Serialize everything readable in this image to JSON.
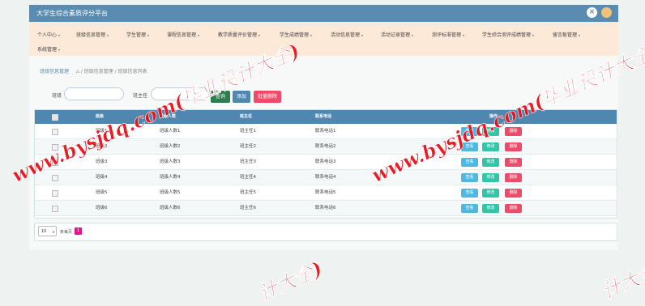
{
  "app": {
    "title": "大学生综合素质评分平台",
    "close_icon": "⨯"
  },
  "nav": [
    {
      "label": "个人中心",
      "caret": "▾"
    },
    {
      "label": "班级信息管理",
      "caret": "▾"
    },
    {
      "label": "学生管理",
      "caret": "▾"
    },
    {
      "label": "课程信息管理",
      "caret": "▾"
    },
    {
      "label": "教学质量评价管理",
      "caret": "▾"
    },
    {
      "label": "学生成绩管理",
      "caret": "▾"
    },
    {
      "label": "活动信息管理",
      "caret": "▾"
    },
    {
      "label": "活动记录管理",
      "caret": "▾"
    },
    {
      "label": "测评标准管理",
      "caret": "▾"
    },
    {
      "label": "学生综合测评成绩管理",
      "caret": "▾"
    },
    {
      "label": "留言板管理",
      "caret": "▾"
    },
    {
      "label": "系统管理",
      "caret": "▾"
    }
  ],
  "breadcrumb": {
    "current": "班级信息管理",
    "home_icon": "⌂",
    "path": "/ 班级信息管理 / 班级信息列表"
  },
  "search": {
    "class_label": "班级",
    "class_value": "",
    "teacher_label": "班主任",
    "teacher_value": "",
    "search_button": "查询",
    "add_button": "添加",
    "batch_delete_button": "批量删除"
  },
  "table": {
    "headers": [
      "",
      "班级",
      "班级人数",
      "班主任",
      "联系电话",
      "操作"
    ],
    "rows": [
      [
        "班级1",
        "班级人数1",
        "班主任1",
        "联系电话1"
      ],
      [
        "班级2",
        "班级人数2",
        "班主任2",
        "联系电话2"
      ],
      [
        "班级3",
        "班级人数3",
        "班主任3",
        "联系电话3"
      ],
      [
        "班级4",
        "班级人数4",
        "班主任4",
        "联系电话4"
      ],
      [
        "班级5",
        "班级人数5",
        "班主任5",
        "联系电话5"
      ],
      [
        "班级6",
        "班级人数6",
        "班主任6",
        "联系电话6"
      ]
    ],
    "actions": {
      "view": "查看",
      "edit": "修改",
      "delete": "删除"
    }
  },
  "pagination": {
    "page_size": "10",
    "per_page_label": "条每页",
    "current_page": "1"
  },
  "watermarks": [
    "www.bysjdq.com(毕业设计大全)",
    "www.bysjdq.com(毕业设计大全)",
    "计大全)",
    "计大全)"
  ],
  "colors": {
    "header": "#5a8bb0",
    "nav_bg": "#fde9d8",
    "view": "#4fb8e0",
    "edit": "#32c6a8",
    "delete": "#f04a6a",
    "search": "#2e7d4f",
    "add": "#4f87b0",
    "batch_delete": "#f04a6a",
    "watermark": "#e8101a"
  }
}
